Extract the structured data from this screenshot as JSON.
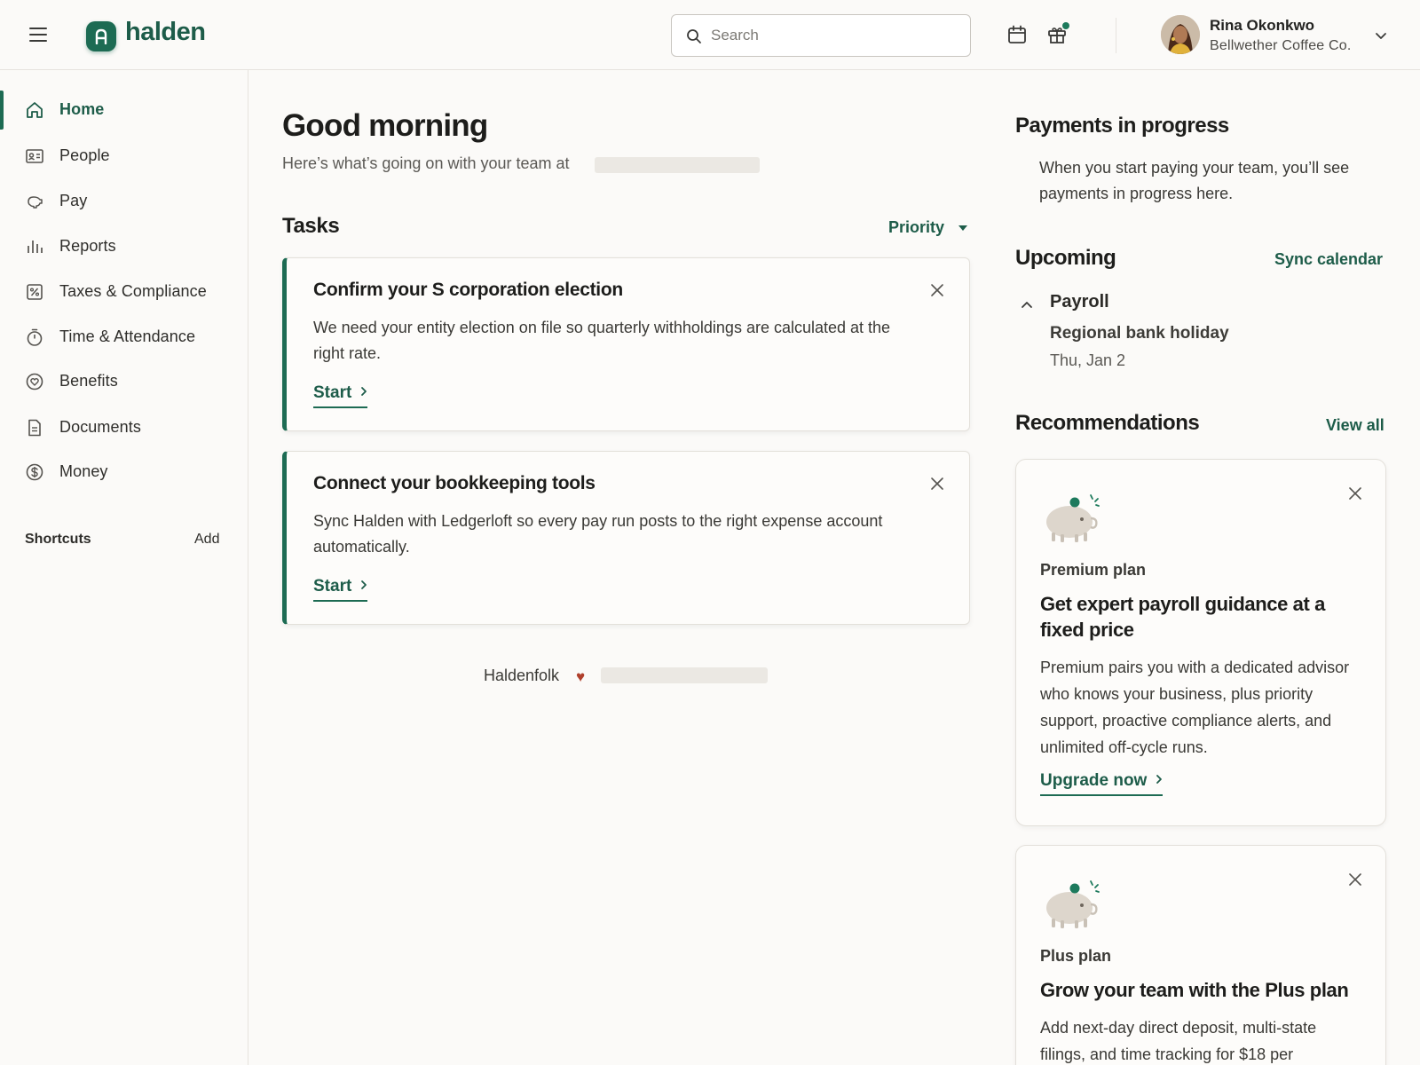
{
  "app": {
    "logo_text": "halden",
    "brand_color": "#1d6b53",
    "accent_text_color": "#1d5c49"
  },
  "header": {
    "menu_icon": "hamburger-menu-icon",
    "search_placeholder": "Search",
    "calendar_icon": "calendar-icon",
    "gift_icon": "gift-icon",
    "user": {
      "name": "Rina Okonkwo",
      "company": "Bellwether Coffee Co."
    }
  },
  "sidebar": {
    "items": [
      {
        "label": "Home",
        "icon": "home-icon",
        "active": true
      },
      {
        "label": "People",
        "icon": "id-card-icon"
      },
      {
        "label": "Pay",
        "icon": "piggy-bank-icon"
      },
      {
        "label": "Reports",
        "icon": "bar-chart-icon"
      },
      {
        "label": "Taxes & Compliance",
        "icon": "percent-icon"
      },
      {
        "label": "Time & Attendance",
        "icon": "stopwatch-icon"
      },
      {
        "label": "Benefits",
        "icon": "heart-badge-icon"
      },
      {
        "label": "Documents",
        "icon": "document-icon"
      },
      {
        "label": "Money",
        "icon": "dollar-circle-icon"
      }
    ],
    "shortcuts_title": "Shortcuts",
    "shortcuts_add": "Add"
  },
  "main": {
    "greeting": "Good morning",
    "subtitle": "Here’s what’s going on with your team at",
    "tasks_title": "Tasks",
    "sort_label": "Priority",
    "tasks": [
      {
        "title": "Confirm your S corporation election",
        "body": "We need your entity election on file so quarterly withholdings are calculated at the right rate.",
        "action": "Start"
      },
      {
        "title": "Connect your bookkeeping tools",
        "body": "Sync Halden with Ledgerloft so every pay run posts to the right expense account automatically.",
        "action": "Start"
      }
    ],
    "footer_text": "Haldenfolk",
    "footer_heart": "♥"
  },
  "right": {
    "payments": {
      "title": "Payments in progress",
      "text": "When you start paying your team, you’ll see payments in progress here."
    },
    "upcoming": {
      "title": "Upcoming",
      "sync_label": "Sync calendar",
      "category": "Payroll",
      "event": "Regional bank holiday",
      "date": "Thu, Jan 2"
    },
    "recommendations": {
      "title": "Recommendations",
      "view_all": "View all",
      "cards": [
        {
          "plan": "Premium plan",
          "title": "Get expert payroll guidance at a fixed price",
          "body": "Premium pairs you with a dedicated advisor who knows your business, plus priority support, proactive compliance alerts, and unlimited off-cycle runs.",
          "action": "Upgrade now"
        },
        {
          "plan": "Plus plan",
          "title": "Grow your team with the Plus plan",
          "body": "Add next-day direct deposit, multi-state filings, and time tracking for $18 per"
        }
      ]
    }
  }
}
